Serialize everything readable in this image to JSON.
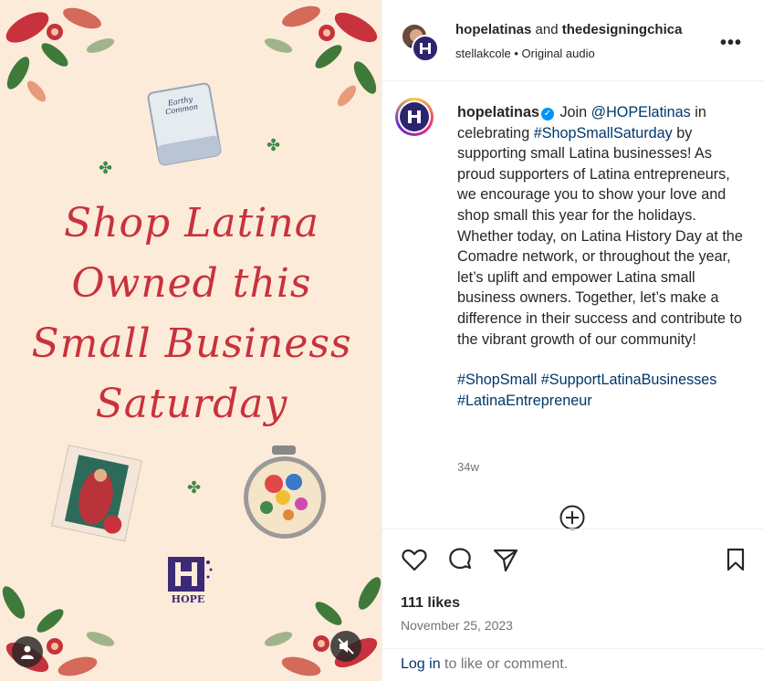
{
  "media": {
    "title_lines": [
      "Shop Latina",
      "Owned this",
      "Small Business",
      "Saturday"
    ],
    "candle_label": "Earthy Common",
    "logo_text": "HOPE",
    "icons": [
      "person-icon",
      "speaker-muted-icon"
    ]
  },
  "header": {
    "user1": "hopelatinas",
    "and_text": "and",
    "user2": "thedesigningchica",
    "audio_author": "stellakcole",
    "separator": "•",
    "audio_label": "Original audio",
    "more_label": "•••"
  },
  "caption": {
    "username": "hopelatinas",
    "verified": "✓",
    "text_part1": " Join ",
    "mention": "@HOPElatinas",
    "text_part2": " in celebrating ",
    "hashtag_inline": "#ShopSmallSaturday",
    "text_part3": " by supporting small Latina businesses! As proud supporters of Latina entrepreneurs, we encourage you to show your love and shop small this year for the holidays. Whether today, on Latina History Day at the Comadre network, or throughout the year, let’s uplift and empower Latina small business owners. Together, let’s make a difference in their success and contribute to the vibrant growth of our community!",
    "hashtags": [
      "#ShopSmall",
      "#SupportLatinaBusinesses",
      "#LatinaEntrepreneur"
    ],
    "time": "34w"
  },
  "actions": {
    "likes": "111 likes",
    "date": "November 25, 2023",
    "login_link": "Log in",
    "login_rest": " to like or comment."
  },
  "colors": {
    "title_red": "#c8323c",
    "link_blue": "#00376b",
    "verified_blue": "#0095f6",
    "media_bg": "#fdebd9"
  }
}
